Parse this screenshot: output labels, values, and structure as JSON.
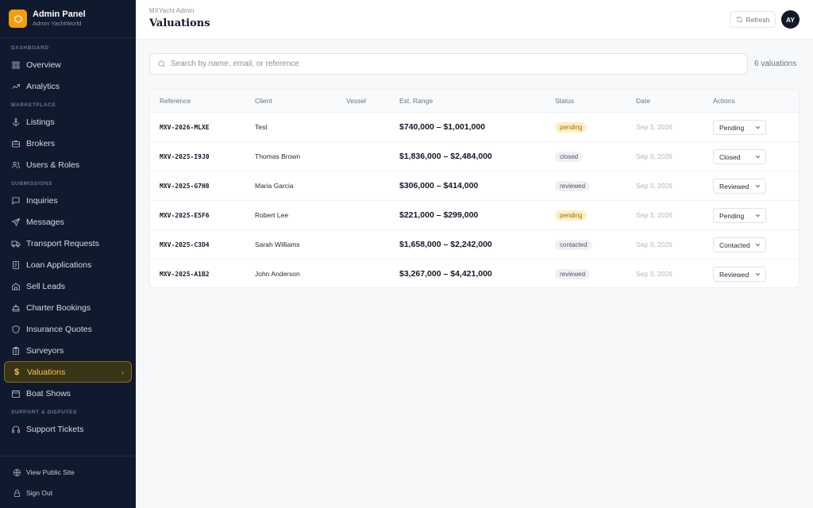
{
  "brand": {
    "title": "Admin Panel",
    "subtitle": "Admin YachtWorld"
  },
  "sidebar": {
    "sections": [
      {
        "label": "DASHBOARD",
        "items": [
          {
            "label": "Overview",
            "icon": "grid-icon"
          },
          {
            "label": "Analytics",
            "icon": "trend-icon"
          }
        ]
      },
      {
        "label": "MARKETPLACE",
        "items": [
          {
            "label": "Listings",
            "icon": "anchor-icon"
          },
          {
            "label": "Brokers",
            "icon": "briefcase-icon"
          },
          {
            "label": "Users & Roles",
            "icon": "users-icon"
          }
        ]
      },
      {
        "label": "SUBMISSIONS",
        "items": [
          {
            "label": "Inquiries",
            "icon": "message-square-icon"
          },
          {
            "label": "Messages",
            "icon": "send-icon"
          },
          {
            "label": "Transport Requests",
            "icon": "truck-icon"
          },
          {
            "label": "Loan Applications",
            "icon": "file-icon"
          },
          {
            "label": "Sell Leads",
            "icon": "home-icon"
          },
          {
            "label": "Charter Bookings",
            "icon": "ship-icon"
          },
          {
            "label": "Insurance Quotes",
            "icon": "shield-icon"
          },
          {
            "label": "Surveyors",
            "icon": "clipboard-icon"
          },
          {
            "label": "Valuations",
            "icon": "dollar-icon",
            "active": true
          },
          {
            "label": "Boat Shows",
            "icon": "calendar-icon"
          }
        ]
      },
      {
        "label": "SUPPORT & DISPUTES",
        "items": [
          {
            "label": "Support Tickets",
            "icon": "headset-icon"
          }
        ]
      }
    ],
    "footer": [
      {
        "label": "View Public Site",
        "icon": "globe-icon"
      },
      {
        "label": "Sign Out",
        "icon": "lock-icon"
      }
    ]
  },
  "header": {
    "breadcrumb": "MXYacht Admin",
    "title": "Valuations",
    "refresh_label": "Refresh",
    "avatar_initials": "AY"
  },
  "search": {
    "placeholder": "Search by name, email, or reference",
    "value": ""
  },
  "result_count": "6 valuations",
  "table": {
    "columns": [
      "Reference",
      "Client",
      "Vessel",
      "Est. Range",
      "Status",
      "Date",
      "Actions"
    ],
    "rows": [
      {
        "reference": "MXV-2026-MLXE",
        "client": "Test",
        "vessel": "",
        "range": "$740,000 – $1,001,000",
        "status": "pending",
        "date": "Sep 3, 2026",
        "action": "Pending"
      },
      {
        "reference": "MXV-2025-I9J0",
        "client": "Thomas Brown",
        "vessel": "",
        "range": "$1,836,000 – $2,484,000",
        "status": "closed",
        "date": "Sep 3, 2026",
        "action": "Closed"
      },
      {
        "reference": "MXV-2025-G7H8",
        "client": "Maria Garcia",
        "vessel": "",
        "range": "$306,000 – $414,000",
        "status": "reviewed",
        "date": "Sep 3, 2026",
        "action": "Reviewed"
      },
      {
        "reference": "MXV-2025-E5F6",
        "client": "Robert Lee",
        "vessel": "",
        "range": "$221,000 – $299,000",
        "status": "pending",
        "date": "Sep 3, 2026",
        "action": "Pending"
      },
      {
        "reference": "MXV-2025-C3D4",
        "client": "Sarah Williams",
        "vessel": "",
        "range": "$1,658,000 – $2,242,000",
        "status": "contacted",
        "date": "Sep 3, 2026",
        "action": "Contacted"
      },
      {
        "reference": "MXV-2025-A1B2",
        "client": "John Anderson",
        "vessel": "",
        "range": "$3,267,000 – $4,421,000",
        "status": "reviewed",
        "date": "Sep 3, 2026",
        "action": "Reviewed"
      }
    ]
  },
  "colors": {
    "sidebar_bg": "#0f1a2e",
    "accent": "#f5c542",
    "pending_bg": "#fdf0c4",
    "pending_text": "#a86a07"
  }
}
